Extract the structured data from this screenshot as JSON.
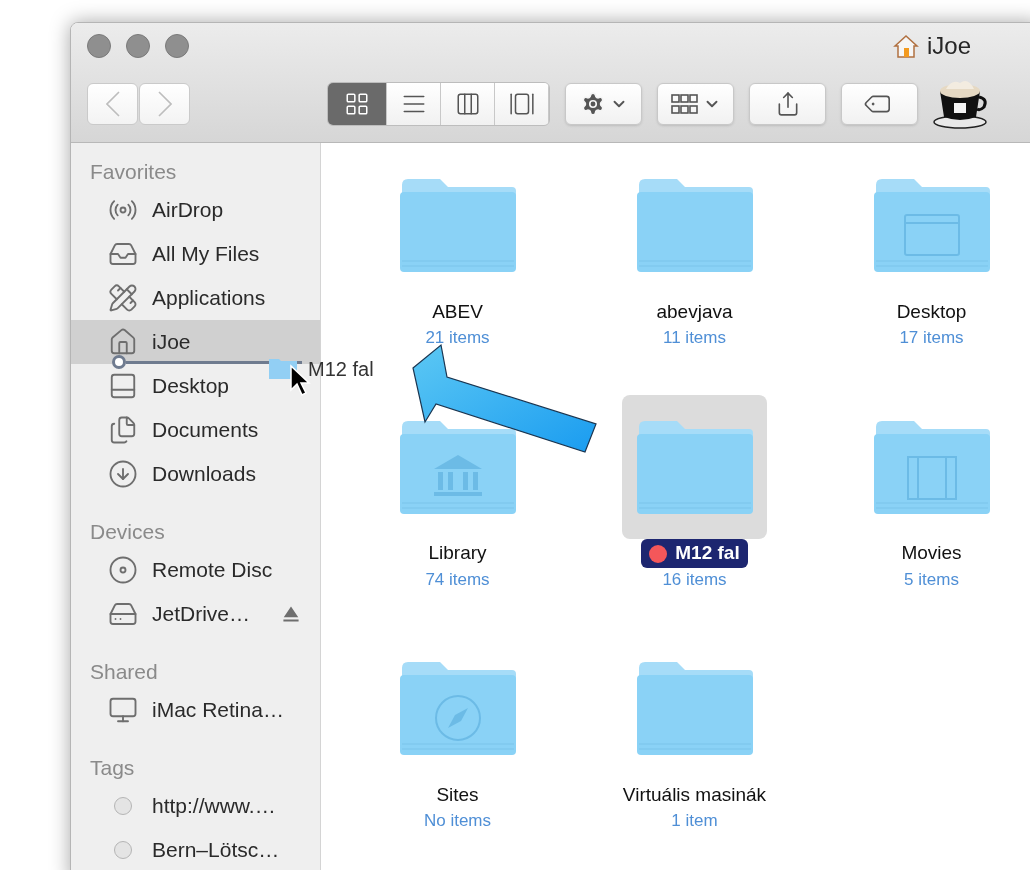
{
  "window": {
    "title": "iJoe"
  },
  "toolbar": {
    "nav": [
      {
        "kind": "back",
        "disabled": true
      },
      {
        "kind": "forward",
        "disabled": true
      }
    ],
    "view_modes": [
      {
        "kind": "icons",
        "selected": true
      },
      {
        "kind": "list",
        "selected": false
      },
      {
        "kind": "columns",
        "selected": false
      },
      {
        "kind": "coverflow",
        "selected": false
      }
    ],
    "actions": [
      {
        "kind": "gear"
      },
      {
        "kind": "arrange"
      },
      {
        "kind": "share"
      },
      {
        "kind": "tag"
      }
    ]
  },
  "sidebar": {
    "sections": [
      {
        "heading": "Favorites",
        "items": [
          {
            "kind": "airdrop",
            "label": "AirDrop",
            "selected": false
          },
          {
            "kind": "files",
            "label": "All My Files",
            "selected": false
          },
          {
            "kind": "apps",
            "label": "Applications",
            "selected": false
          },
          {
            "kind": "home",
            "label": "iJoe",
            "selected": true
          },
          {
            "kind": "desktop",
            "label": "Desktop",
            "selected": false
          },
          {
            "kind": "documents",
            "label": "Documents",
            "selected": false
          },
          {
            "kind": "downloads",
            "label": "Downloads",
            "selected": false
          }
        ]
      },
      {
        "heading": "Devices",
        "items": [
          {
            "kind": "disc",
            "label": "Remote Disc",
            "selected": false
          },
          {
            "kind": "drive",
            "label": "JetDrive…",
            "selected": false,
            "eject": true
          }
        ]
      },
      {
        "heading": "Shared",
        "items": [
          {
            "kind": "computer",
            "label": "iMac Retina…",
            "selected": false
          }
        ]
      },
      {
        "heading": "Tags",
        "items": [
          {
            "kind": "tag",
            "label": "http://www.…",
            "selected": false
          },
          {
            "kind": "tag",
            "label": "Bern–Lötsc…",
            "selected": false
          }
        ]
      }
    ]
  },
  "drag": {
    "label": "M12 fal"
  },
  "folders": [
    {
      "kind": "plain",
      "name": "ABEV",
      "count": "21 items",
      "selected": false
    },
    {
      "kind": "plain",
      "name": "abevjava",
      "count": "11 items",
      "selected": false
    },
    {
      "kind": "desktop",
      "name": "Desktop",
      "count": "17 items",
      "selected": false
    },
    {
      "kind": "library",
      "name": "Library",
      "count": "74 items",
      "selected": false
    },
    {
      "kind": "plain",
      "name": "M12 fal",
      "count": "16 items",
      "selected": true,
      "color": "#f4575a"
    },
    {
      "kind": "movies",
      "name": "Movies",
      "count": "5 items",
      "selected": false
    },
    {
      "kind": "sites",
      "name": "Sites",
      "count": "No items",
      "selected": false
    },
    {
      "kind": "plain",
      "name": "Virtuális masinák",
      "count": "1 item",
      "selected": false
    }
  ]
}
